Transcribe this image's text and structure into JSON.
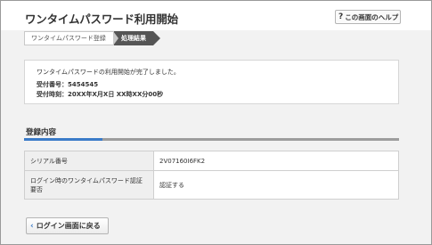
{
  "header": {
    "title": "ワンタイムパスワード利用開始",
    "help_label": "この画面のヘルプ",
    "help_icon_text": "?"
  },
  "stepper": {
    "steps": [
      {
        "label": "ワンタイムパスワード登録"
      },
      {
        "label": "処理結果"
      }
    ]
  },
  "message": {
    "main": "ワンタイムパスワードの利用開始が完了しました。",
    "receipt_number_label": "受付番号：",
    "receipt_number": "5454545",
    "receipt_time_label": "受付時刻：",
    "receipt_time": "20XX年X月X日 XX時XX分00秒"
  },
  "section": {
    "title": "登録内容"
  },
  "table": {
    "rows": [
      {
        "label": "シリアル番号",
        "value": "2V07160I6FK2"
      },
      {
        "label1": "ログイン時のワンタイムパスワード認証",
        "label2": "要否",
        "value": "認証する"
      }
    ]
  },
  "footer": {
    "back_label": "ログイン画面に戻る",
    "back_icon_text": "‹"
  },
  "colors": {
    "accent": "#3a7bc8",
    "active_step": "#555555"
  }
}
